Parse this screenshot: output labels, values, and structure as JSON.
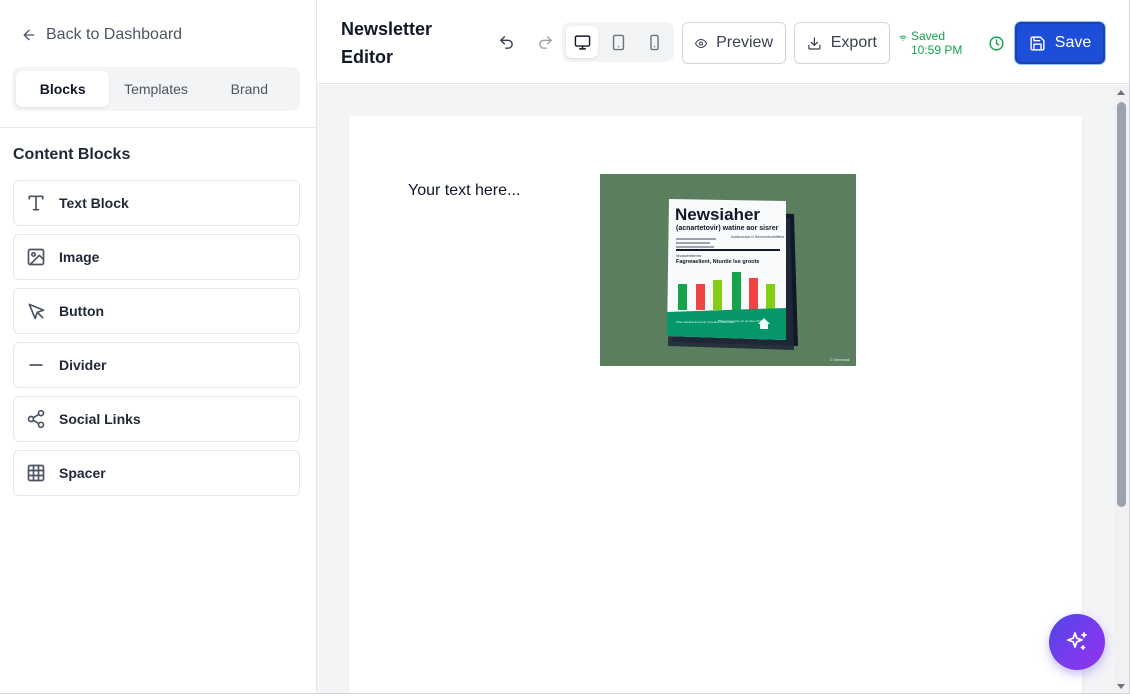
{
  "sidebar": {
    "back_label": "Back to Dashboard",
    "tabs": [
      {
        "label": "Blocks",
        "active": true
      },
      {
        "label": "Templates",
        "active": false
      },
      {
        "label": "Brand",
        "active": false
      }
    ],
    "section_title": "Content Blocks",
    "blocks": [
      {
        "label": "Text Block",
        "icon": "type-icon"
      },
      {
        "label": "Image",
        "icon": "image-icon"
      },
      {
        "label": "Button",
        "icon": "cursor-pointer-icon"
      },
      {
        "label": "Divider",
        "icon": "minus-icon"
      },
      {
        "label": "Social Links",
        "icon": "share-icon"
      },
      {
        "label": "Spacer",
        "icon": "grid-icon"
      }
    ]
  },
  "header": {
    "title": "Newsletter Editor",
    "preview_label": "Preview",
    "export_label": "Export",
    "saved_status": "Saved 10:59 PM",
    "save_label": "Save",
    "active_device": "desktop"
  },
  "canvas": {
    "text_block": "Your text here..."
  },
  "image_block": {
    "headline": "Newsiaher",
    "subhead": "(acnartetovir) watine aor sisrer",
    "side_note": "Inclarunrace ci Hermcertumbiffene",
    "section_label": "Nnussienberhes",
    "chart_caption": "Fagrwaelient, Ntuntie lse groote",
    "footer_left": "Sbeu bttettrdeinsmenrl nretuaise rhettenase",
    "footer_right": "Bhtes ttrecunrse ptt ert sltee ttfrle",
    "credit": "© Stmertnak"
  },
  "colors": {
    "accent": "#1d4ed8",
    "saved_green": "#16a34a",
    "image_background": "#5b7f5e",
    "newspaper_green": "#059669",
    "fab_gradient_start": "#4f46e5",
    "fab_gradient_end": "#9333ea"
  }
}
